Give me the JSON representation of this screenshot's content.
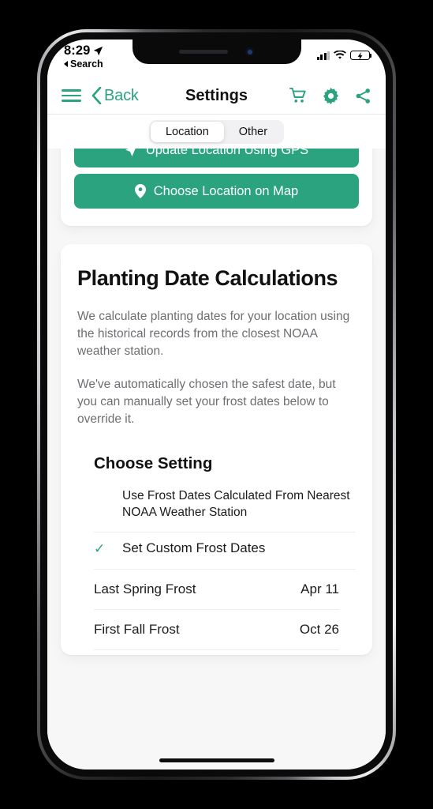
{
  "status_bar": {
    "time": "8:29",
    "location_arrow_icon": "location-arrow-icon",
    "back_label": "Search",
    "signal_icon": "cellular-signal-icon",
    "wifi_icon": "wifi-icon",
    "battery_icon": "battery-charging-icon"
  },
  "nav": {
    "menu_icon": "hamburger-menu-icon",
    "back_label": "Back",
    "title": "Settings",
    "cart_icon": "shopping-cart-icon",
    "settings_icon": "gear-icon",
    "share_icon": "share-icon"
  },
  "segmented_control": {
    "options": [
      {
        "label": "Location",
        "selected": true
      },
      {
        "label": "Other",
        "selected": false
      }
    ]
  },
  "location_card": {
    "gps_button_label": "Update Location Using GPS",
    "gps_button_icon": "navigation-arrow-icon",
    "map_button_label": "Choose Location on Map",
    "map_button_icon": "map-pin-icon"
  },
  "planting_card": {
    "title": "Planting Date Calculations",
    "paragraph_1": "We calculate planting dates for your location using the historical records from the closest NOAA weather station.",
    "paragraph_2": "We've automatically chosen the safest date, but you can manually set your frost dates below to override it.",
    "choose_setting_heading": "Choose Setting",
    "options": [
      {
        "label": "Use Frost Dates Calculated From Nearest NOAA Weather Station",
        "selected": false,
        "check": ""
      },
      {
        "label": "Set Custom Frost Dates",
        "selected": true,
        "check": "✓"
      }
    ],
    "dates": [
      {
        "label": "Last Spring Frost",
        "value": "Apr 11"
      },
      {
        "label": "First Fall Frost",
        "value": "Oct 26"
      }
    ]
  },
  "colors": {
    "accent_green": "#2aa37e",
    "battery_green": "#34c759",
    "page_background": "#f7f7f8",
    "card_background": "#ffffff",
    "body_text": "#6e6e73"
  }
}
